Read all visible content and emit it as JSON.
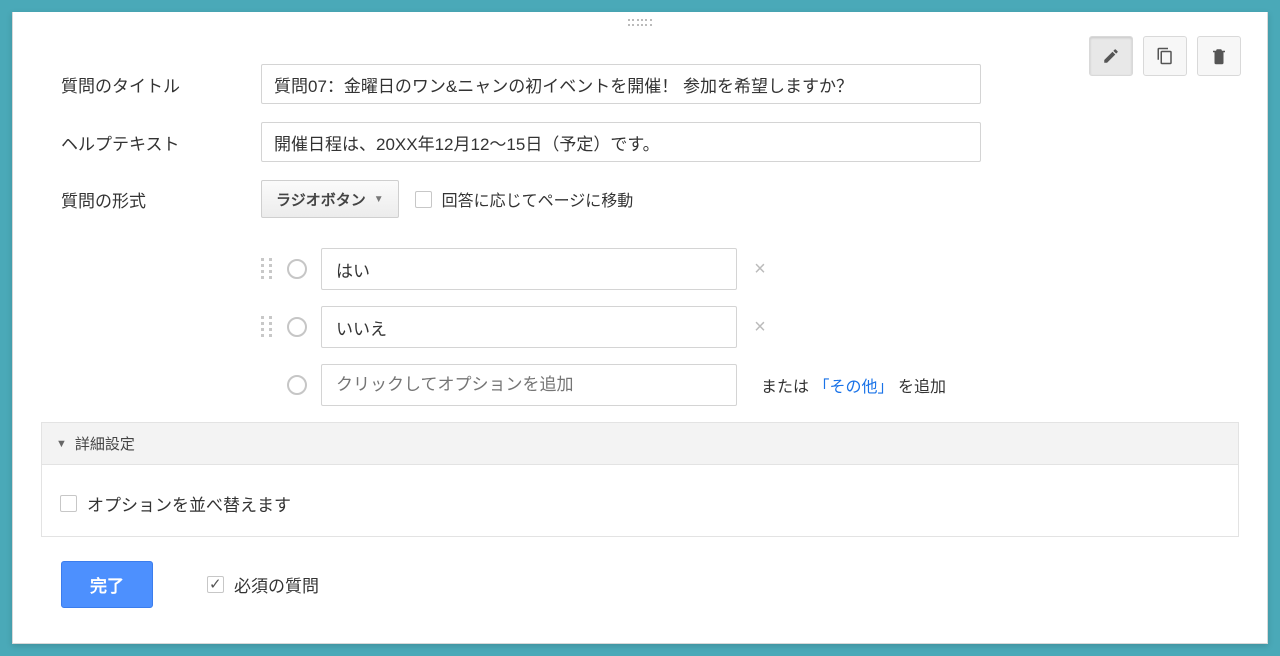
{
  "labels": {
    "question_title": "質問のタイトル",
    "help_text": "ヘルプテキスト",
    "question_type": "質問の形式"
  },
  "fields": {
    "title_value": "質問07：金曜日のワン&ニャンの初イベントを開催！ 参加を希望しますか？",
    "help_value": "開催日程は、20XX年12月12〜15日（予定）です。"
  },
  "question_type": {
    "selected": "ラジオボタン",
    "page_nav_label": "回答に応じてページに移動",
    "page_nav_checked": false
  },
  "options": [
    {
      "value": "はい"
    },
    {
      "value": "いいえ"
    }
  ],
  "add_option": {
    "placeholder": "クリックしてオプションを追加",
    "or_text": "または",
    "other_link": "「その他」",
    "add_suffix": "を追加"
  },
  "advanced": {
    "header": "詳細設定",
    "shuffle_label": "オプションを並べ替えます",
    "shuffle_checked": false
  },
  "footer": {
    "done": "完了",
    "required_label": "必須の質問",
    "required_checked": true
  },
  "icons": {
    "edit": "edit",
    "copy": "copy",
    "delete": "delete"
  }
}
